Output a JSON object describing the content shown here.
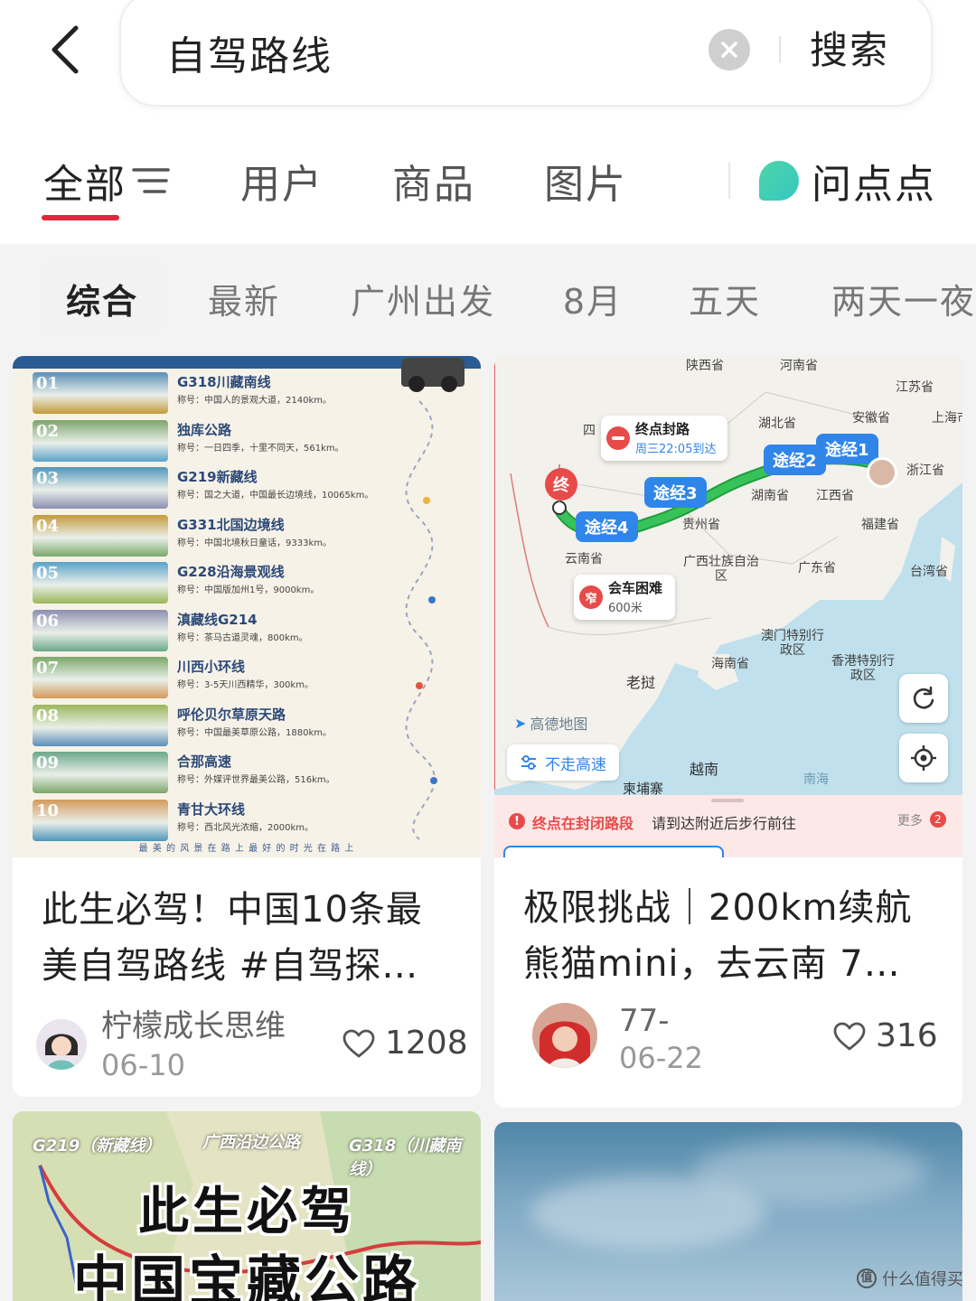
{
  "header": {
    "search_query": "自驾路线",
    "search_button": "搜索"
  },
  "tabs": [
    {
      "label": "全部"
    },
    {
      "label": "用户"
    },
    {
      "label": "商品"
    },
    {
      "label": "图片"
    }
  ],
  "ask": {
    "label": "问点点"
  },
  "chips": [
    "综合",
    "最新",
    "广州出发",
    "8月",
    "五天",
    "两天一夜"
  ],
  "cards": [
    {
      "title_line1": "此生必驾！中国10条最",
      "title_line2": "美自驾路线 #自驾探…",
      "author": "柠檬成长思维",
      "date": "06-10",
      "likes": "1208",
      "routes": [
        {
          "num": "01",
          "name": "G318川藏南线",
          "desc": "称号：中国人的景观大道，2140km。"
        },
        {
          "num": "02",
          "name": "独库公路",
          "desc": "称号：一日四季，十里不同天，561km。"
        },
        {
          "num": "03",
          "name": "G219新藏线",
          "desc": "称号：国之大道，中国最长边境线，10065km。"
        },
        {
          "num": "04",
          "name": "G331北国边境线",
          "desc": "称号：中国北境秋日童话，9333km。"
        },
        {
          "num": "05",
          "name": "G228沿海景观线",
          "desc": "称号：中国版加州1号，9000km。"
        },
        {
          "num": "06",
          "name": "滇藏线G214",
          "desc": "称号：茶马古道灵魂，800km。"
        },
        {
          "num": "07",
          "name": "川西小环线",
          "desc": "称号：3-5天川西精华，300km。"
        },
        {
          "num": "08",
          "name": "呼伦贝尔草原天路",
          "desc": "称号：中国最美草原公路，1880km。"
        },
        {
          "num": "09",
          "name": "合那高速",
          "desc": "称号：外媒评世界最美公路，516km。"
        },
        {
          "num": "10",
          "name": "青甘大环线",
          "desc": "称号：西北风光浓缩，2000km。"
        }
      ],
      "footer_text": "最 美 的 风 景 在 路 上          最 好 的 时 光 在 路 上"
    },
    {
      "title_line1": "极限挑战｜200km续航",
      "title_line2": "熊猫mini，去云南 7…",
      "author": "77-",
      "date": "06-22",
      "likes": "316",
      "map": {
        "end_title": "终点封路",
        "end_sub": "周三22:05到达",
        "end_marker": "终",
        "via": [
          "途经1",
          "途经2",
          "途经3",
          "途经4"
        ],
        "hard_title": "会车困难",
        "hard_sub": "600米",
        "hard_marker": "窄",
        "no_highway": "不走高速",
        "brand": "高德地图",
        "warn_text": "终点在封闭路段",
        "warn_sub": "请到达附近后步行前往",
        "more": "更多",
        "more_count": "2",
        "regions": [
          "陕西省",
          "河南省",
          "江苏省",
          "湖北省",
          "安徽省",
          "上海市",
          "浙江省",
          "湖南省",
          "江西省",
          "贵州省",
          "福建省",
          "云南省",
          "广西壮族自治区",
          "广东省",
          "台湾省",
          "澳门特别行政区",
          "香港特别行政区",
          "海南省",
          "老挝",
          "越南",
          "柬埔寨",
          "南海",
          "四"
        ]
      }
    },
    {
      "overlay_line1": "此生必驾",
      "overlay_line2": "中国宝藏公路",
      "map_labels": [
        "G219（新藏线）",
        "广西沿边公路",
        "G318（川藏南线）"
      ]
    }
  ],
  "watermark": "什么值得买"
}
